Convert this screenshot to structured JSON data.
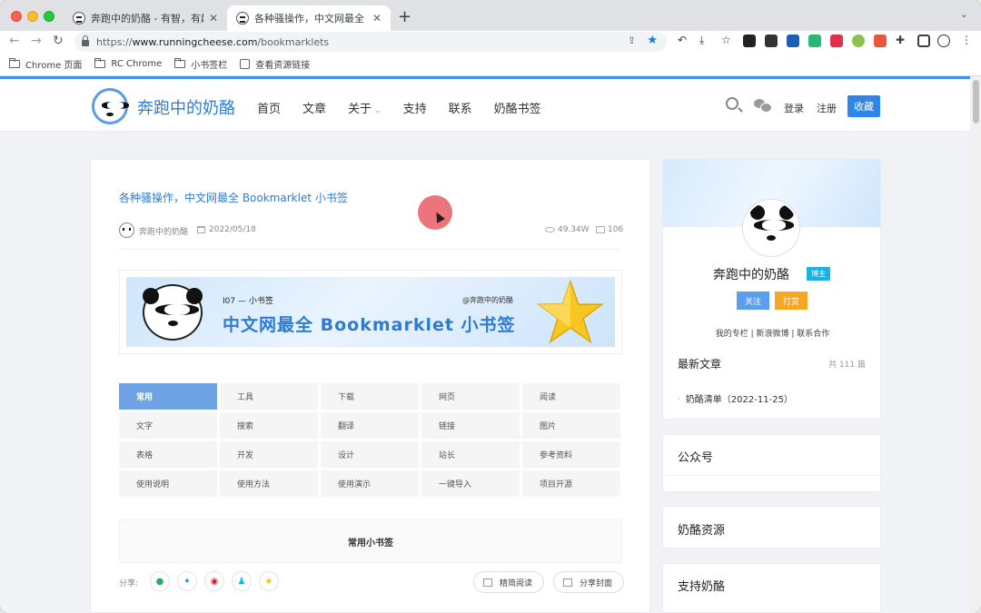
{
  "browser": {
    "tabs": [
      {
        "title": "奔跑中的奶酪 - 有智，有趣，",
        "active": false
      },
      {
        "title": "各种骚操作，中文网最全 Book",
        "active": true
      }
    ],
    "tab_close": "✕",
    "new_tab": "+",
    "tab_menu": "⌄",
    "url": {
      "scheme": "https://",
      "host": "www.runningcheese.com",
      "path": "/bookmarklets"
    },
    "nav": {
      "back": "←",
      "forward": "→",
      "reload": "↻"
    },
    "bookmarks": [
      {
        "label": "Chrome 页面",
        "icon": "folder-icon"
      },
      {
        "label": "RC Chrome",
        "icon": "folder-icon"
      },
      {
        "label": "小书签栏",
        "icon": "folder-icon"
      },
      {
        "label": "查看资源链接",
        "icon": "link-icon"
      }
    ],
    "accent_color": "#1a73e8"
  },
  "site": {
    "name": "奔跑中的奶酪",
    "nav": [
      {
        "label": "首页"
      },
      {
        "label": "文章"
      },
      {
        "label": "关于",
        "caret": "⌄"
      },
      {
        "label": "支持"
      },
      {
        "label": "联系"
      },
      {
        "label": "奶酪书签"
      }
    ],
    "login": "登录",
    "register": "注册",
    "collect": "收藏",
    "brand_color": "#2f7bd2"
  },
  "article": {
    "title": "各种骚操作，中文网最全 Bookmarklet 小书签",
    "author": "奔跑中的奶酪",
    "date": "2022/05/18",
    "views": "49.34W",
    "comments": "106",
    "banner": {
      "subtitle": "I07 — 小书签",
      "credit": "@奔跑中的奶酪",
      "headline": "中文网最全 Bookmarklet 小书签"
    },
    "categories": [
      {
        "label": "常用",
        "active": true
      },
      {
        "label": "工具"
      },
      {
        "label": "下载"
      },
      {
        "label": "网页"
      },
      {
        "label": "阅读"
      },
      {
        "label": "文字"
      },
      {
        "label": "搜索"
      },
      {
        "label": "翻译"
      },
      {
        "label": "链接"
      },
      {
        "label": "图片"
      },
      {
        "label": "表格"
      },
      {
        "label": "开发"
      },
      {
        "label": "设计"
      },
      {
        "label": "站长"
      },
      {
        "label": "参考资料"
      },
      {
        "label": "使用说明"
      },
      {
        "label": "使用方法"
      },
      {
        "label": "使用演示"
      },
      {
        "label": "一键导入"
      },
      {
        "label": "项目开源"
      }
    ],
    "section_title": "常用小书签",
    "share_label": "分享:",
    "share_buttons": [
      {
        "icon": "wechat-icon",
        "glyph": "●",
        "color": "#2aae67"
      },
      {
        "icon": "twitter-icon",
        "glyph": "✦",
        "color": "#1da1f2"
      },
      {
        "icon": "weibo-icon",
        "glyph": "◉",
        "color": "#e6162d"
      },
      {
        "icon": "qq-icon",
        "glyph": "♟",
        "color": "#12b7f5"
      },
      {
        "icon": "qzone-icon",
        "glyph": "★",
        "color": "#f5be00"
      }
    ],
    "reader_mode": "精简阅读",
    "share_cover": "分享封面"
  },
  "sidebar": {
    "profile_name": "奔跑中的奶酪",
    "badge": "博主",
    "follow": "关注",
    "tip": "打赏",
    "links": "我的专栏 | 新浪微博 | 联系合作",
    "latest_title": "最新文章",
    "latest_count": "共 111 篇",
    "latest_items": [
      {
        "label": "奶酪清单（2022-11-25）"
      }
    ],
    "widgets": [
      {
        "title": "公众号"
      },
      {
        "title": "奶酪资源"
      },
      {
        "title": "支持奶酪"
      }
    ]
  }
}
